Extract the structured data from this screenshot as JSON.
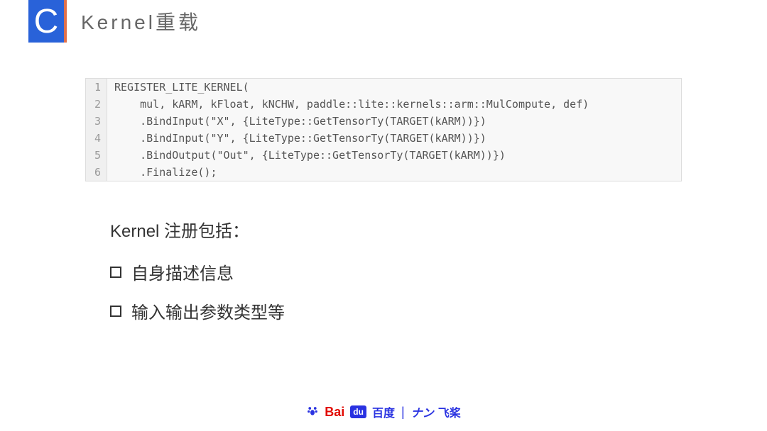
{
  "header": {
    "letter": "C",
    "title": "Kernel重载"
  },
  "code": {
    "lines": [
      {
        "no": "1",
        "text": "REGISTER_LITE_KERNEL("
      },
      {
        "no": "2",
        "text": "    mul, kARM, kFloat, kNCHW, paddle::lite::kernels::arm::MulCompute, def)"
      },
      {
        "no": "3",
        "text": "    .BindInput(\"X\", {LiteType::GetTensorTy(TARGET(kARM))})"
      },
      {
        "no": "4",
        "text": "    .BindInput(\"Y\", {LiteType::GetTensorTy(TARGET(kARM))})"
      },
      {
        "no": "5",
        "text": "    .BindOutput(\"Out\", {LiteType::GetTensorTy(TARGET(kARM))})"
      },
      {
        "no": "6",
        "text": "    .Finalize();"
      }
    ]
  },
  "content": {
    "heading": "Kernel 注册包括：",
    "bullets": [
      "自身描述信息",
      "输入输出参数类型等"
    ]
  },
  "footer": {
    "bai": "Bai",
    "du": "du",
    "baidu_cn": "百度",
    "divider": "|",
    "feijiang_en": "ナン",
    "feijiang_cn": "飞桨"
  }
}
